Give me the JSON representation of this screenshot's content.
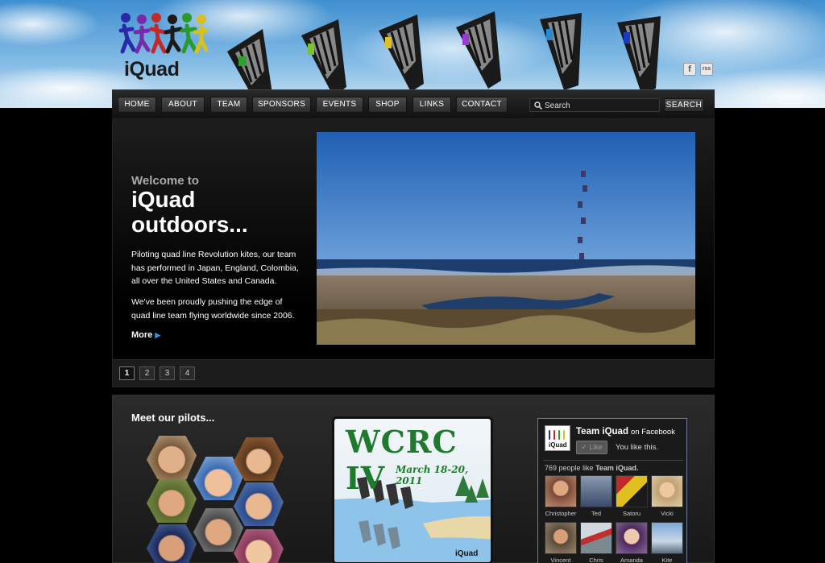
{
  "brand": {
    "logo_text": "iQuad"
  },
  "social": [
    {
      "label": "f",
      "icon": "facebook-icon"
    },
    {
      "label": "rss",
      "icon": "rss-icon"
    }
  ],
  "nav": {
    "items": [
      "HOME",
      "ABOUT",
      "TEAM",
      "SPONSORS",
      "EVENTS",
      "SHOP",
      "LINKS",
      "CONTACT"
    ]
  },
  "search": {
    "placeholder": "Search",
    "button_label": "SEARCH"
  },
  "hero": {
    "welcome": "Welcome to",
    "title": "iQuad outdoors...",
    "paragraph1": "Piloting quad line Revolution kites, our team has performed in Japan, England, Colombia, all over the United States and Canada.",
    "paragraph2": "We've been proudly pushing the edge of quad line team flying worldwide since 2006.",
    "more_label": "More",
    "pages": [
      "1",
      "2",
      "3",
      "4"
    ],
    "active_page": "1"
  },
  "pilots": {
    "title": "Meet our pilots..."
  },
  "poster": {
    "title": "WCRC IV",
    "dates": "March 18-20, 2011",
    "logo_text": "iQuad"
  },
  "facebook": {
    "page_name": "Team iQuad",
    "on_label": "on Facebook",
    "like_label": "Like",
    "you_like": "You like this.",
    "count_text": "769 people like",
    "count_name": "Team iQuad.",
    "fans": [
      "Christopher",
      "Ted",
      "Satoru",
      "Vicki",
      "Vincent",
      "Chris",
      "Amanda",
      "Kite"
    ]
  },
  "colors": {
    "sky": "#3f8fd0",
    "panel": "#1d1d1d",
    "accent_link": "#3d8de0",
    "poster_green": "#1f7a2e"
  }
}
